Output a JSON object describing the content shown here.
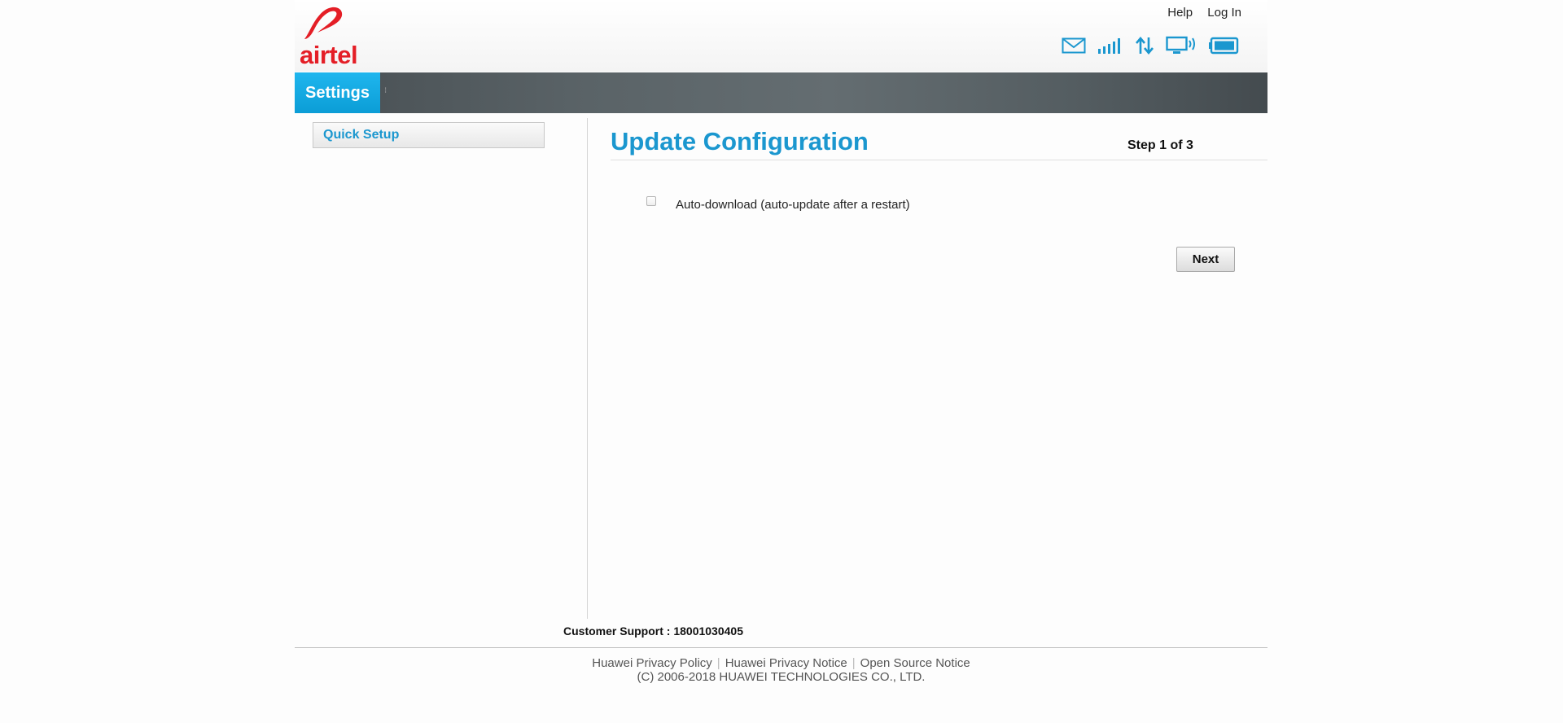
{
  "brand": {
    "logo_text": "airtel",
    "logo_color": "#e41e26"
  },
  "header": {
    "help_label": "Help",
    "login_label": "Log In"
  },
  "status_icons": [
    "mail-icon",
    "signal-strength-icon",
    "data-transfer-icon",
    "connected-device-icon",
    "battery-icon"
  ],
  "nav": {
    "settings_label": "Settings"
  },
  "sidebar": {
    "items": [
      {
        "label": "Quick Setup"
      }
    ]
  },
  "main": {
    "title": "Update Configuration",
    "step": "Step 1 of 3",
    "auto_download": {
      "label": "Auto-download (auto-update after a restart)",
      "checked": false
    },
    "next_label": "Next"
  },
  "footer": {
    "support": "Customer Support : 18001030405",
    "links": [
      "Huawei Privacy Policy",
      "Huawei Privacy Notice",
      "Open Source Notice"
    ],
    "copyright": "(C) 2006-2018 HUAWEI TECHNOLOGIES CO., LTD."
  },
  "colors": {
    "accent": "#1b97cf",
    "nav_active": "#0b9dd6"
  }
}
